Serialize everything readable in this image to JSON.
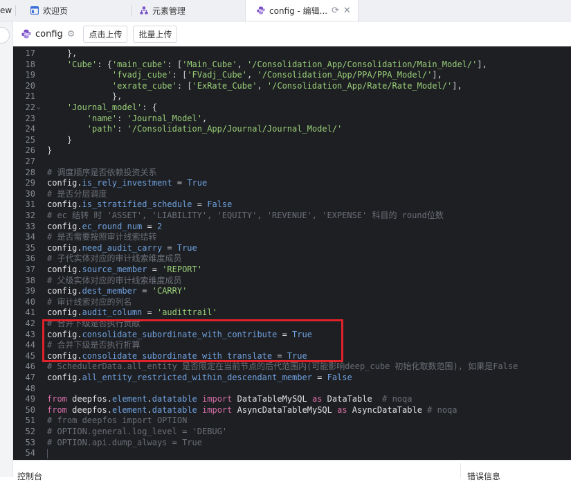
{
  "tabs": [
    {
      "label": "ew"
    },
    {
      "label": "欢迎页"
    },
    {
      "label": "元素管理"
    },
    {
      "label": "config - 编辑..."
    }
  ],
  "toolbar": {
    "file_name": "config",
    "upload_label": "点击上传",
    "batch_upload_label": "批量上传"
  },
  "editor": {
    "lines": [
      {
        "n": "17",
        "fold": "",
        "segs": [
          {
            "c": "op",
            "t": "    },"
          }
        ]
      },
      {
        "n": "18",
        "fold": "",
        "segs": [
          {
            "c": "s",
            "t": "    'Cube'"
          },
          {
            "c": "op",
            "t": ": {"
          },
          {
            "c": "s",
            "t": "'main_cube'"
          },
          {
            "c": "op",
            "t": ": ["
          },
          {
            "c": "s",
            "t": "'Main_Cube'"
          },
          {
            "c": "op",
            "t": ", "
          },
          {
            "c": "s",
            "t": "'/Consolidation_App/Consolidation/Main_Model/'"
          },
          {
            "c": "op",
            "t": "],"
          }
        ]
      },
      {
        "n": "19",
        "fold": "",
        "segs": [
          {
            "c": "s",
            "t": "             'fvadj_cube'"
          },
          {
            "c": "op",
            "t": ": ["
          },
          {
            "c": "s",
            "t": "'FVadj_Cube'"
          },
          {
            "c": "op",
            "t": ", "
          },
          {
            "c": "s",
            "t": "'/Consolidation_App/PPA/PPA_Model/'"
          },
          {
            "c": "op",
            "t": "],"
          }
        ]
      },
      {
        "n": "20",
        "fold": "",
        "segs": [
          {
            "c": "s",
            "t": "             'exrate_cube'"
          },
          {
            "c": "op",
            "t": ": ["
          },
          {
            "c": "s",
            "t": "'ExRate_Cube'"
          },
          {
            "c": "op",
            "t": ", "
          },
          {
            "c": "s",
            "t": "'/Consolidation_App/Rate/Rate_Model/'"
          },
          {
            "c": "op",
            "t": "],"
          }
        ]
      },
      {
        "n": "21",
        "fold": "",
        "segs": [
          {
            "c": "op",
            "t": "             },"
          }
        ]
      },
      {
        "n": "22",
        "fold": "⌄",
        "segs": [
          {
            "c": "s",
            "t": "    'Journal_model'"
          },
          {
            "c": "op",
            "t": ": {"
          }
        ]
      },
      {
        "n": "23",
        "fold": "",
        "segs": [
          {
            "c": "s",
            "t": "        'name'"
          },
          {
            "c": "op",
            "t": ": "
          },
          {
            "c": "s",
            "t": "'Journal_Model'"
          },
          {
            "c": "op",
            "t": ","
          }
        ]
      },
      {
        "n": "24",
        "fold": "",
        "segs": [
          {
            "c": "s",
            "t": "        'path'"
          },
          {
            "c": "op",
            "t": ": "
          },
          {
            "c": "s",
            "t": "'/Consolidation_App/Journal/Journal_Model/'"
          }
        ]
      },
      {
        "n": "25",
        "fold": "",
        "segs": [
          {
            "c": "op",
            "t": "    }"
          }
        ]
      },
      {
        "n": "26",
        "fold": "",
        "segs": [
          {
            "c": "op",
            "t": "}"
          }
        ]
      },
      {
        "n": "27",
        "fold": "",
        "segs": []
      },
      {
        "n": "28",
        "fold": "",
        "segs": [
          {
            "c": "cm",
            "t": "# 调度顺序是否依赖投资关系"
          }
        ]
      },
      {
        "n": "29",
        "fold": "",
        "segs": [
          {
            "c": "k",
            "t": "config."
          },
          {
            "c": "attr",
            "t": "is_rely_investment"
          },
          {
            "c": "op",
            "t": " = "
          },
          {
            "c": "bool",
            "t": "True"
          }
        ]
      },
      {
        "n": "30",
        "fold": "",
        "segs": [
          {
            "c": "cm",
            "t": "# 是否分层调度"
          }
        ]
      },
      {
        "n": "31",
        "fold": "",
        "segs": [
          {
            "c": "k",
            "t": "config."
          },
          {
            "c": "attr",
            "t": "is_stratified_schedule"
          },
          {
            "c": "op",
            "t": " = "
          },
          {
            "c": "bool",
            "t": "False"
          }
        ]
      },
      {
        "n": "32",
        "fold": "",
        "segs": [
          {
            "c": "cm",
            "t": "# ec 结转 时 'ASSET', 'LIABILITY', 'EQUITY', 'REVENUE', 'EXPENSE' 科目的 round位数"
          }
        ]
      },
      {
        "n": "33",
        "fold": "",
        "segs": [
          {
            "c": "k",
            "t": "config."
          },
          {
            "c": "attr",
            "t": "ec_round_num"
          },
          {
            "c": "op",
            "t": " = "
          },
          {
            "c": "num",
            "t": "2"
          }
        ]
      },
      {
        "n": "34",
        "fold": "",
        "segs": [
          {
            "c": "cm",
            "t": "# 是否需要按照审计线索结转"
          }
        ]
      },
      {
        "n": "35",
        "fold": "",
        "segs": [
          {
            "c": "k",
            "t": "config."
          },
          {
            "c": "attr",
            "t": "need_audit_carry"
          },
          {
            "c": "op",
            "t": " = "
          },
          {
            "c": "bool",
            "t": "True"
          }
        ]
      },
      {
        "n": "36",
        "fold": "",
        "segs": [
          {
            "c": "cm",
            "t": "# 子代实体对应的审计线索维度成员"
          }
        ]
      },
      {
        "n": "37",
        "fold": "",
        "segs": [
          {
            "c": "k",
            "t": "config."
          },
          {
            "c": "attr",
            "t": "source_member"
          },
          {
            "c": "op",
            "t": " = "
          },
          {
            "c": "s",
            "t": "'REPORT'"
          }
        ]
      },
      {
        "n": "38",
        "fold": "",
        "segs": [
          {
            "c": "cm",
            "t": "# 父级实体对应的审计线索维度成员"
          }
        ]
      },
      {
        "n": "39",
        "fold": "",
        "segs": [
          {
            "c": "k",
            "t": "config."
          },
          {
            "c": "attr",
            "t": "dest_member"
          },
          {
            "c": "op",
            "t": " = "
          },
          {
            "c": "s",
            "t": "'CARRY'"
          }
        ]
      },
      {
        "n": "40",
        "fold": "",
        "segs": [
          {
            "c": "cm",
            "t": "# 审计线索对应的列名"
          }
        ]
      },
      {
        "n": "41",
        "fold": "",
        "segs": [
          {
            "c": "k",
            "t": "config."
          },
          {
            "c": "attr",
            "t": "audit_column"
          },
          {
            "c": "op",
            "t": " = "
          },
          {
            "c": "s",
            "t": "'audittrail'"
          }
        ]
      },
      {
        "n": "42",
        "fold": "",
        "segs": [
          {
            "c": "cm",
            "t": "# 合并下级是否执行贡献"
          }
        ]
      },
      {
        "n": "43",
        "fold": "",
        "segs": [
          {
            "c": "k",
            "t": "config."
          },
          {
            "c": "attr",
            "t": "consolidate_subordinate_with_contribute"
          },
          {
            "c": "op",
            "t": " = "
          },
          {
            "c": "bool",
            "t": "True"
          }
        ]
      },
      {
        "n": "44",
        "fold": "",
        "segs": [
          {
            "c": "cm",
            "t": "# 合并下级是否执行折算"
          }
        ]
      },
      {
        "n": "45",
        "fold": "",
        "segs": [
          {
            "c": "k",
            "t": "config."
          },
          {
            "c": "attr",
            "t": "consolidate_subordinate_with_translate"
          },
          {
            "c": "op",
            "t": " = "
          },
          {
            "c": "bool",
            "t": "True"
          }
        ]
      },
      {
        "n": "46",
        "fold": "",
        "segs": [
          {
            "c": "cm",
            "t": "# SchedulerData.all_entity 是否限定在当前节点的后代范围内(可能影响deep_cube 初始化取数范围), 如果是False"
          }
        ]
      },
      {
        "n": "47",
        "fold": "",
        "segs": [
          {
            "c": "k",
            "t": "config."
          },
          {
            "c": "attr",
            "t": "all_entity_restricted_within_descendant_member"
          },
          {
            "c": "op",
            "t": " = "
          },
          {
            "c": "bool",
            "t": "False"
          }
        ]
      },
      {
        "n": "48",
        "fold": "",
        "segs": []
      },
      {
        "n": "49",
        "fold": "",
        "segs": [
          {
            "c": "kw",
            "t": "from"
          },
          {
            "c": "k",
            "t": " deepfos."
          },
          {
            "c": "attr",
            "t": "element"
          },
          {
            "c": "k",
            "t": "."
          },
          {
            "c": "attr",
            "t": "datatable"
          },
          {
            "c": "k",
            "t": " "
          },
          {
            "c": "kw",
            "t": "import"
          },
          {
            "c": "k",
            "t": " DataTableMySQL "
          },
          {
            "c": "kw",
            "t": "as"
          },
          {
            "c": "k",
            "t": " DataTable  "
          },
          {
            "c": "cm",
            "t": "# noqa"
          }
        ]
      },
      {
        "n": "50",
        "fold": "",
        "segs": [
          {
            "c": "kw",
            "t": "from"
          },
          {
            "c": "k",
            "t": " deepfos."
          },
          {
            "c": "attr",
            "t": "element"
          },
          {
            "c": "k",
            "t": "."
          },
          {
            "c": "attr",
            "t": "datatable"
          },
          {
            "c": "k",
            "t": " "
          },
          {
            "c": "kw",
            "t": "import"
          },
          {
            "c": "k",
            "t": " AsyncDataTableMySQL "
          },
          {
            "c": "kw",
            "t": "as"
          },
          {
            "c": "k",
            "t": " AsyncDataTable "
          },
          {
            "c": "cm",
            "t": "# noqa"
          }
        ]
      },
      {
        "n": "51",
        "fold": "",
        "segs": [
          {
            "c": "cm",
            "t": "# from deepfos import OPTION"
          }
        ]
      },
      {
        "n": "52",
        "fold": "",
        "segs": [
          {
            "c": "cm",
            "t": "# OPTION.general.log_level = 'DEBUG'"
          }
        ]
      },
      {
        "n": "53",
        "fold": "",
        "segs": [
          {
            "c": "cm",
            "t": "# OPTION.api.dump_always = True"
          }
        ]
      },
      {
        "n": "54",
        "fold": "",
        "segs": []
      }
    ]
  },
  "bottom": {
    "console_label": "控制台",
    "error_label": "错误信息"
  },
  "colors": {
    "editor_bg": "#1e1f22",
    "highlight_box": "#e0222a"
  }
}
